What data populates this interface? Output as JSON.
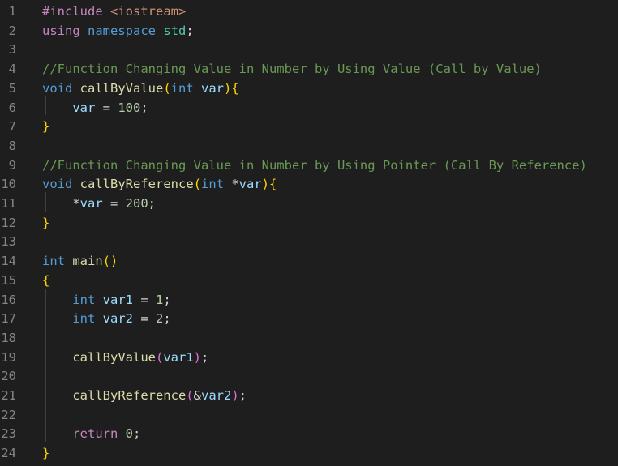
{
  "editor": {
    "language": "cpp",
    "theme_colors": {
      "background": "#1e1e1e",
      "line_number": "#858585",
      "keyword": "#569cd6",
      "control_keyword": "#c586c0",
      "function": "#dcdcaa",
      "variable": "#9cdcfe",
      "number": "#b5cea8",
      "string": "#ce9178",
      "comment": "#6a9955",
      "bracket_level_1": "#ffd700",
      "bracket_level_2": "#da70d6"
    },
    "lines": [
      {
        "num": "1",
        "tokens": [
          {
            "t": "#include ",
            "c": "pre"
          },
          {
            "t": "<iostream>",
            "c": "str"
          }
        ]
      },
      {
        "num": "2",
        "tokens": [
          {
            "t": "using",
            "c": "pre"
          },
          {
            "t": " ",
            "c": "plain"
          },
          {
            "t": "namespace",
            "c": "kw"
          },
          {
            "t": " ",
            "c": "plain"
          },
          {
            "t": "std",
            "c": "type"
          },
          {
            "t": ";",
            "c": "plain"
          }
        ]
      },
      {
        "num": "3",
        "tokens": []
      },
      {
        "num": "4",
        "tokens": [
          {
            "t": "//Function Changing Value in Number by Using Value (Call by Value)",
            "c": "com"
          }
        ]
      },
      {
        "num": "5",
        "tokens": [
          {
            "t": "void",
            "c": "kw"
          },
          {
            "t": " ",
            "c": "plain"
          },
          {
            "t": "callByValue",
            "c": "func"
          },
          {
            "t": "(",
            "c": "b1"
          },
          {
            "t": "int",
            "c": "kw"
          },
          {
            "t": " ",
            "c": "plain"
          },
          {
            "t": "var",
            "c": "var"
          },
          {
            "t": ")",
            "c": "b1"
          },
          {
            "t": "{",
            "c": "b1"
          }
        ]
      },
      {
        "num": "6",
        "tokens": [
          {
            "t": "    ",
            "c": "plain"
          },
          {
            "t": "var",
            "c": "var"
          },
          {
            "t": " = ",
            "c": "plain"
          },
          {
            "t": "100",
            "c": "num"
          },
          {
            "t": ";",
            "c": "plain"
          }
        ]
      },
      {
        "num": "7",
        "tokens": [
          {
            "t": "}",
            "c": "b1"
          }
        ]
      },
      {
        "num": "8",
        "tokens": []
      },
      {
        "num": "9",
        "tokens": [
          {
            "t": "//Function Changing Value in Number by Using Pointer (Call By Reference)",
            "c": "com"
          }
        ]
      },
      {
        "num": "10",
        "tokens": [
          {
            "t": "void",
            "c": "kw"
          },
          {
            "t": " ",
            "c": "plain"
          },
          {
            "t": "callByReference",
            "c": "func"
          },
          {
            "t": "(",
            "c": "b1"
          },
          {
            "t": "int",
            "c": "kw"
          },
          {
            "t": " *",
            "c": "plain"
          },
          {
            "t": "var",
            "c": "var"
          },
          {
            "t": ")",
            "c": "b1"
          },
          {
            "t": "{",
            "c": "b1"
          }
        ]
      },
      {
        "num": "11",
        "tokens": [
          {
            "t": "    *",
            "c": "plain"
          },
          {
            "t": "var",
            "c": "var"
          },
          {
            "t": " = ",
            "c": "plain"
          },
          {
            "t": "200",
            "c": "num"
          },
          {
            "t": ";",
            "c": "plain"
          }
        ]
      },
      {
        "num": "12",
        "tokens": [
          {
            "t": "}",
            "c": "b1"
          }
        ]
      },
      {
        "num": "13",
        "tokens": []
      },
      {
        "num": "14",
        "tokens": [
          {
            "t": "int",
            "c": "kw"
          },
          {
            "t": " ",
            "c": "plain"
          },
          {
            "t": "main",
            "c": "func"
          },
          {
            "t": "()",
            "c": "b1"
          }
        ]
      },
      {
        "num": "15",
        "tokens": [
          {
            "t": "{",
            "c": "b1"
          }
        ]
      },
      {
        "num": "16",
        "tokens": [
          {
            "t": "    ",
            "c": "plain"
          },
          {
            "t": "int",
            "c": "kw"
          },
          {
            "t": " ",
            "c": "plain"
          },
          {
            "t": "var1",
            "c": "var"
          },
          {
            "t": " = ",
            "c": "plain"
          },
          {
            "t": "1",
            "c": "num"
          },
          {
            "t": ";",
            "c": "plain"
          }
        ]
      },
      {
        "num": "17",
        "tokens": [
          {
            "t": "    ",
            "c": "plain"
          },
          {
            "t": "int",
            "c": "kw"
          },
          {
            "t": " ",
            "c": "plain"
          },
          {
            "t": "var2",
            "c": "var"
          },
          {
            "t": " = ",
            "c": "plain"
          },
          {
            "t": "2",
            "c": "num"
          },
          {
            "t": ";",
            "c": "plain"
          }
        ]
      },
      {
        "num": "18",
        "tokens": []
      },
      {
        "num": "19",
        "tokens": [
          {
            "t": "    ",
            "c": "plain"
          },
          {
            "t": "callByValue",
            "c": "func"
          },
          {
            "t": "(",
            "c": "b2"
          },
          {
            "t": "var1",
            "c": "var"
          },
          {
            "t": ")",
            "c": "b2"
          },
          {
            "t": ";",
            "c": "plain"
          }
        ]
      },
      {
        "num": "20",
        "tokens": []
      },
      {
        "num": "21",
        "tokens": [
          {
            "t": "    ",
            "c": "plain"
          },
          {
            "t": "callByReference",
            "c": "func"
          },
          {
            "t": "(",
            "c": "b2"
          },
          {
            "t": "&",
            "c": "plain"
          },
          {
            "t": "var2",
            "c": "var"
          },
          {
            "t": ")",
            "c": "b2"
          },
          {
            "t": ";",
            "c": "plain"
          }
        ]
      },
      {
        "num": "22",
        "tokens": []
      },
      {
        "num": "23",
        "tokens": [
          {
            "t": "    ",
            "c": "plain"
          },
          {
            "t": "return",
            "c": "ctrl"
          },
          {
            "t": " ",
            "c": "plain"
          },
          {
            "t": "0",
            "c": "num"
          },
          {
            "t": ";",
            "c": "plain"
          }
        ]
      },
      {
        "num": "24",
        "tokens": [
          {
            "t": "}",
            "c": "b1"
          }
        ]
      }
    ]
  }
}
